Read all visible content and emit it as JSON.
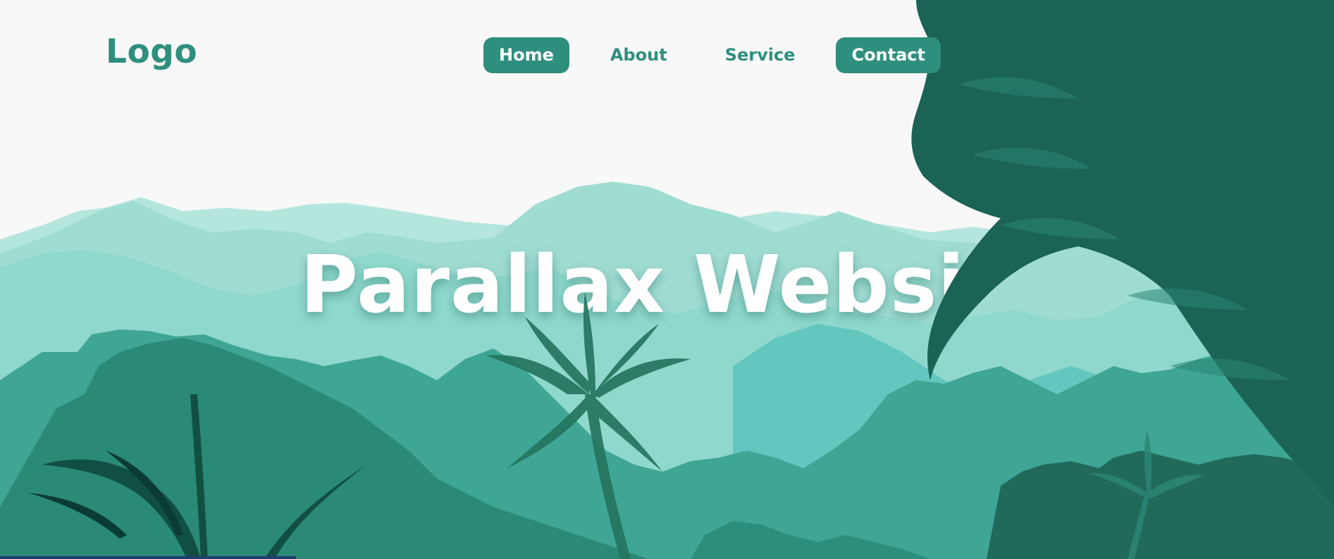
{
  "header": {
    "logo_text": "Logo",
    "nav": [
      {
        "label": "Home",
        "active": true
      },
      {
        "label": "About",
        "active": false
      },
      {
        "label": "Service",
        "active": false
      },
      {
        "label": "Contact",
        "active": true
      }
    ]
  },
  "hero": {
    "title": "Parallax Websi"
  },
  "colors": {
    "accent": "#2f8f7e",
    "page_background": "#f8f8f8",
    "mountains_far": "#b4e6de",
    "mountains_mid": "#8fd8cc",
    "forest_dark": "#1f6e5e",
    "leaves": "#1b6354"
  }
}
